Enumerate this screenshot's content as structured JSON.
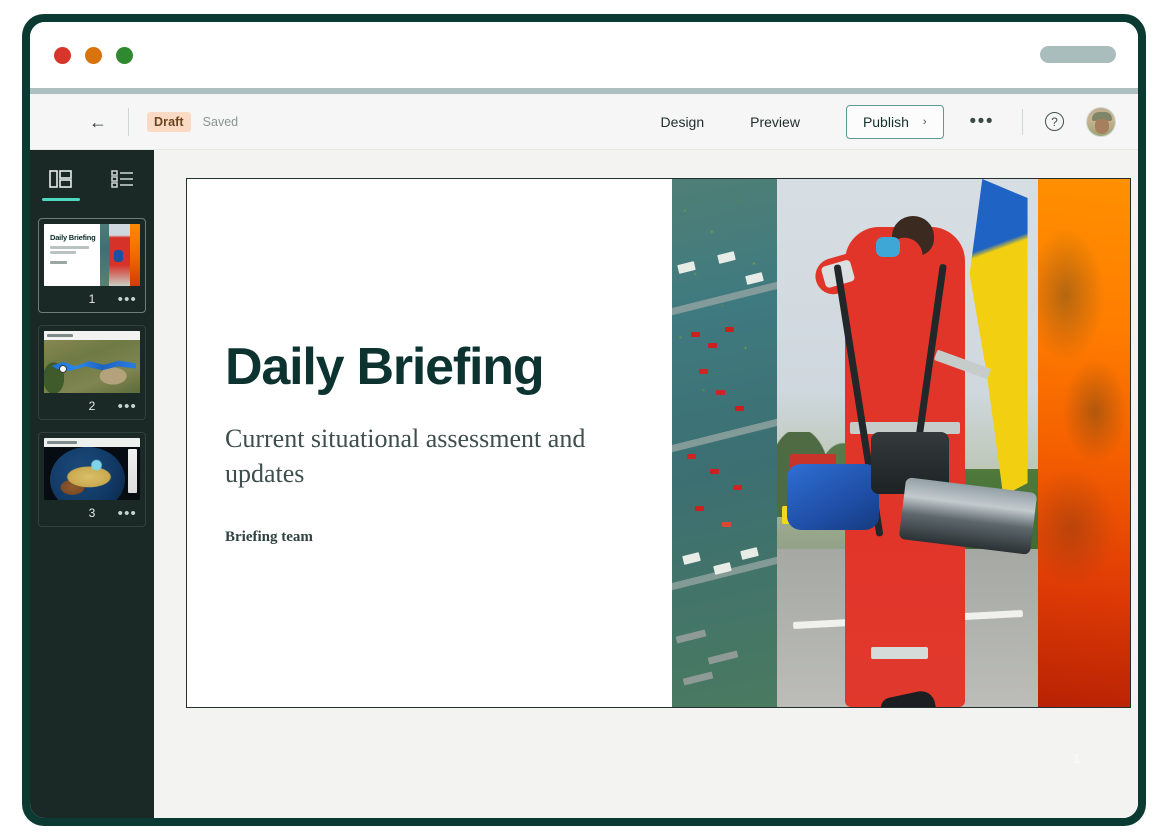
{
  "window": {
    "traffic_lights": [
      "close",
      "minimize",
      "maximize"
    ],
    "url_placeholder": ""
  },
  "toolbar": {
    "back_label": "←",
    "status_badge": "Draft",
    "saved_label": "Saved",
    "design_label": "Design",
    "preview_label": "Preview",
    "publish_label": "Publish",
    "publish_chevron": "›",
    "more_label": "•••",
    "help_label": "?",
    "accent_color": "#5a9c92",
    "badge_bg": "#fbdac5"
  },
  "sidebar": {
    "tabs": [
      {
        "name": "layout-grid",
        "active": true
      },
      {
        "name": "outline-list",
        "active": false
      }
    ],
    "slides": [
      {
        "number": "1",
        "menu": "•••",
        "selected": true,
        "title": "Daily Briefing"
      },
      {
        "number": "2",
        "menu": "•••",
        "selected": false,
        "title": ""
      },
      {
        "number": "3",
        "menu": "•••",
        "selected": false,
        "title": ""
      }
    ]
  },
  "slide": {
    "title": "Daily Briefing",
    "subtitle": "Current situational assessment and updates",
    "author": "Briefing team",
    "page_number": "1",
    "title_color": "#0d3330",
    "images": [
      {
        "name": "aerial-flood-photo"
      },
      {
        "name": "paramedic-photo"
      },
      {
        "name": "thermal-fire-imagery"
      }
    ]
  }
}
